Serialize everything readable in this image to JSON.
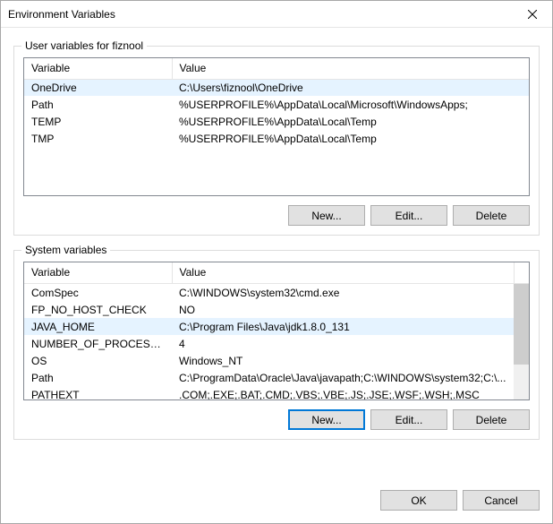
{
  "title": "Environment Variables",
  "userGroup": {
    "label": "User variables for fiznool",
    "headers": {
      "var": "Variable",
      "val": "Value"
    },
    "rows": [
      {
        "var": "OneDrive",
        "val": "C:\\Users\\fiznool\\OneDrive",
        "selected": true
      },
      {
        "var": "Path",
        "val": "%USERPROFILE%\\AppData\\Local\\Microsoft\\WindowsApps;",
        "selected": false
      },
      {
        "var": "TEMP",
        "val": "%USERPROFILE%\\AppData\\Local\\Temp",
        "selected": false
      },
      {
        "var": "TMP",
        "val": "%USERPROFILE%\\AppData\\Local\\Temp",
        "selected": false
      }
    ],
    "buttons": {
      "new": "New...",
      "edit": "Edit...",
      "delete": "Delete"
    }
  },
  "sysGroup": {
    "label": "System variables",
    "headers": {
      "var": "Variable",
      "val": "Value"
    },
    "rows": [
      {
        "var": "ComSpec",
        "val": "C:\\WINDOWS\\system32\\cmd.exe",
        "selected": false
      },
      {
        "var": "FP_NO_HOST_CHECK",
        "val": "NO",
        "selected": false
      },
      {
        "var": "JAVA_HOME",
        "val": "C:\\Program Files\\Java\\jdk1.8.0_131",
        "selected": true
      },
      {
        "var": "NUMBER_OF_PROCESSORS",
        "val": "4",
        "selected": false
      },
      {
        "var": "OS",
        "val": "Windows_NT",
        "selected": false
      },
      {
        "var": "Path",
        "val": "C:\\ProgramData\\Oracle\\Java\\javapath;C:\\WINDOWS\\system32;C:\\...",
        "selected": false
      },
      {
        "var": "PATHEXT",
        "val": ".COM;.EXE;.BAT;.CMD;.VBS;.VBE;.JS;.JSE;.WSF;.WSH;.MSC",
        "selected": false
      }
    ],
    "buttons": {
      "new": "New...",
      "edit": "Edit...",
      "delete": "Delete"
    }
  },
  "footer": {
    "ok": "OK",
    "cancel": "Cancel"
  }
}
